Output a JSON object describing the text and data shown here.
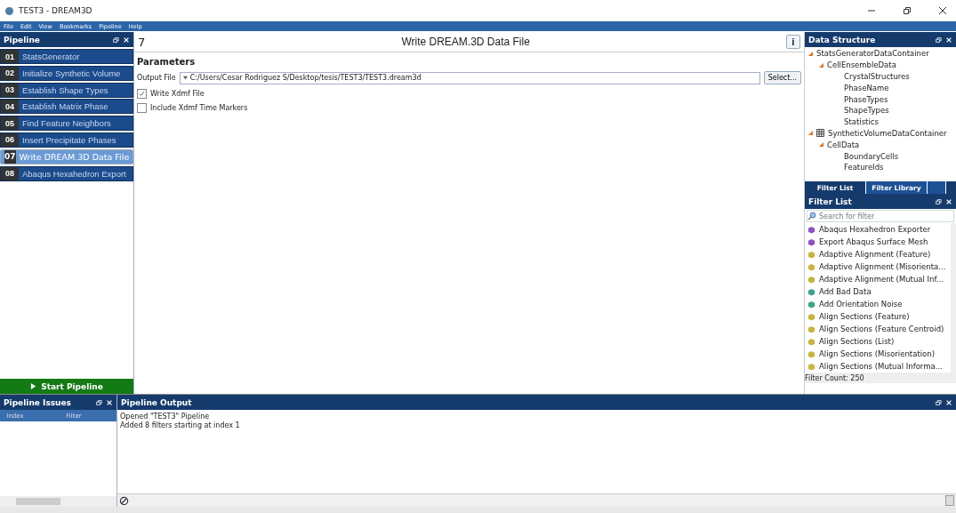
{
  "window": {
    "title": "TEST3 - DREAM3D"
  },
  "menu": [
    "File",
    "Edit",
    "View",
    "Bookmarks",
    "Pipeline",
    "Help"
  ],
  "pipeline": {
    "title": "Pipeline",
    "items": [
      {
        "number": "01",
        "label": "StatsGenerator",
        "selected": false
      },
      {
        "number": "02",
        "label": "Initialize Synthetic Volume",
        "selected": false
      },
      {
        "number": "03",
        "label": "Establish Shape Types",
        "selected": false
      },
      {
        "number": "04",
        "label": "Establish Matrix Phase",
        "selected": false
      },
      {
        "number": "05",
        "label": "Find Feature Neighbors",
        "selected": false
      },
      {
        "number": "06",
        "label": "Insert Precipitate Phases",
        "selected": false
      },
      {
        "number": "07",
        "label": "Write DREAM.3D Data File",
        "selected": true
      },
      {
        "number": "08",
        "label": "Abaqus Hexahedron Export",
        "selected": false
      }
    ],
    "start_button": "Start Pipeline"
  },
  "filter_panel": {
    "index": "7",
    "title": "Write DREAM.3D Data File",
    "info_button": "i",
    "section": "Parameters",
    "output_file": {
      "label": "Output File",
      "value": "C:/Users/Cesar Rodriguez S/Desktop/tesis/TEST3/TEST3.dream3d",
      "button": "Select..."
    },
    "options": [
      {
        "label": "Write Xdmf File",
        "checked": true
      },
      {
        "label": "Include Xdmf Time Markers",
        "checked": false
      }
    ]
  },
  "data_structure": {
    "title": "Data Structure",
    "tree": [
      {
        "label": "StatsGeneratorDataContainer",
        "expanded": true,
        "children": [
          {
            "label": "CellEnsembleData",
            "expanded": true,
            "children": [
              {
                "label": "CrystalStructures"
              },
              {
                "label": "PhaseName"
              },
              {
                "label": "PhaseTypes"
              },
              {
                "label": "ShapeTypes"
              },
              {
                "label": "Statistics"
              }
            ]
          }
        ]
      },
      {
        "label": "SyntheticVolumeDataContainer",
        "grid": true,
        "expanded": true,
        "children": [
          {
            "label": "CellData",
            "expanded": true,
            "children": [
              {
                "label": "BoundaryCells"
              },
              {
                "label": "FeatureIds"
              }
            ]
          }
        ]
      }
    ]
  },
  "dock_tabs": [
    {
      "label": "Filter List",
      "selected": true
    },
    {
      "label": "Filter Library",
      "selected": false
    }
  ],
  "filter_list": {
    "title": "Filter List",
    "placeholder": "Search for filter",
    "items": [
      {
        "label": "Abaqus Hexahedron Exporter",
        "color": "#8e4fc4"
      },
      {
        "label": "Export Abaqus Surface Mesh",
        "color": "#8e4fc4"
      },
      {
        "label": "Adaptive Alignment (Feature)",
        "color": "#c9b43c"
      },
      {
        "label": "Adaptive Alignment (Misorienta...",
        "color": "#c9b43c"
      },
      {
        "label": "Adaptive Alignment (Mutual Inf...",
        "color": "#c9b43c"
      },
      {
        "label": "Add Bad Data",
        "color": "#3aa58a"
      },
      {
        "label": "Add Orientation Noise",
        "color": "#3aa58a"
      },
      {
        "label": "Align Sections (Feature)",
        "color": "#c9b43c"
      },
      {
        "label": "Align Sections (Feature Centroid)",
        "color": "#c9b43c"
      },
      {
        "label": "Align Sections (List)",
        "color": "#c9b43c"
      },
      {
        "label": "Align Sections (Misorientation)",
        "color": "#c9b43c"
      },
      {
        "label": "Align Sections (Mutual Informa...",
        "color": "#c9b43c"
      }
    ],
    "count": "Filter Count: 250"
  },
  "pipeline_issues": {
    "title": "Pipeline Issues",
    "columns": [
      "Index",
      "Filter"
    ]
  },
  "pipeline_output": {
    "title": "Pipeline Output",
    "lines": [
      "Opened \"TEST3\" Pipeline",
      "Added 8 filters starting at index 1"
    ]
  }
}
